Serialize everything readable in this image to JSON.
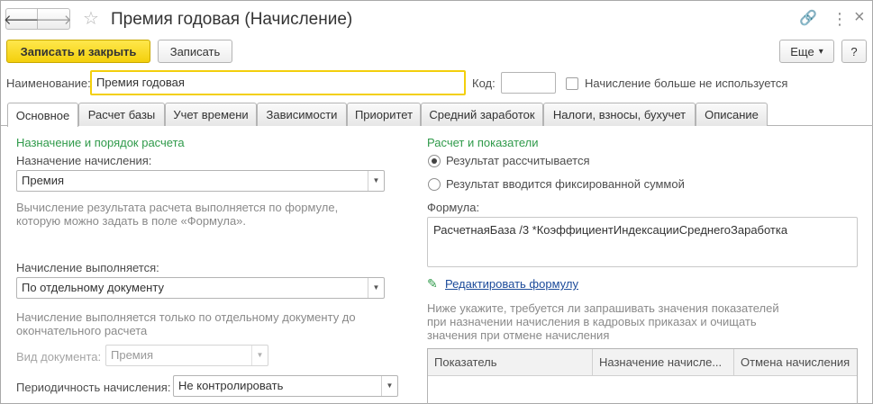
{
  "window": {
    "title": "Премия годовая (Начисление)",
    "back_glyph": "🡐",
    "forward_glyph": "🡒",
    "star_glyph": "☆",
    "link_glyph": "🔗",
    "more_glyph": "⋮",
    "close_glyph": "×"
  },
  "toolbar": {
    "save_close_label": "Записать и закрыть",
    "save_label": "Записать",
    "more_label": "Еще",
    "more_arrow": "▾",
    "help_label": "?"
  },
  "header_fields": {
    "name_label": "Наименование:",
    "name_value": "Премия годовая",
    "code_label": "Код:",
    "code_value": "",
    "unused_label": "Начисление больше не используется"
  },
  "tabs": [
    {
      "label": "Основное"
    },
    {
      "label": "Расчет базы"
    },
    {
      "label": "Учет времени"
    },
    {
      "label": "Зависимости"
    },
    {
      "label": "Приоритет"
    },
    {
      "label": "Средний заработок"
    },
    {
      "label": "Налоги, взносы, бухучет"
    },
    {
      "label": "Описание"
    }
  ],
  "left": {
    "section_title": "Назначение и порядок расчета",
    "purpose_label": "Назначение начисления:",
    "purpose_value": "Премия",
    "purpose_hint_1": "Вычисление результата расчета выполняется по формуле,",
    "purpose_hint_2": "которую можно задать в поле «Формула».",
    "exec_label": "Начисление выполняется:",
    "exec_value": "По отдельному документу",
    "exec_hint_1": "Начисление выполняется только по отдельному документу до",
    "exec_hint_2": "окончательного расчета",
    "doc_type_label": "Вид документа:",
    "doc_type_value": "Премия",
    "period_label": "Периодичность начисления:",
    "period_value": "Не контролировать"
  },
  "right": {
    "section_title": "Расчет и показатели",
    "radio_calculated": "Результат рассчитывается",
    "radio_fixed": "Результат вводится фиксированной суммой",
    "formula_label": "Формула:",
    "formula_value": "РасчетнаяБаза /3 *КоэффициентИндексацииСреднегоЗаработка",
    "edit_formula_link": "Редактировать формулу",
    "edit_icon": "✎",
    "hint_1": "Ниже укажите, требуется ли запрашивать значения показателей",
    "hint_2": "при назначении начисления в кадровых приказах и очищать",
    "hint_3": "значения при отмене начисления",
    "grid_headers": [
      "Показатель",
      "Назначение начисле...",
      "Отмена начисления"
    ]
  }
}
